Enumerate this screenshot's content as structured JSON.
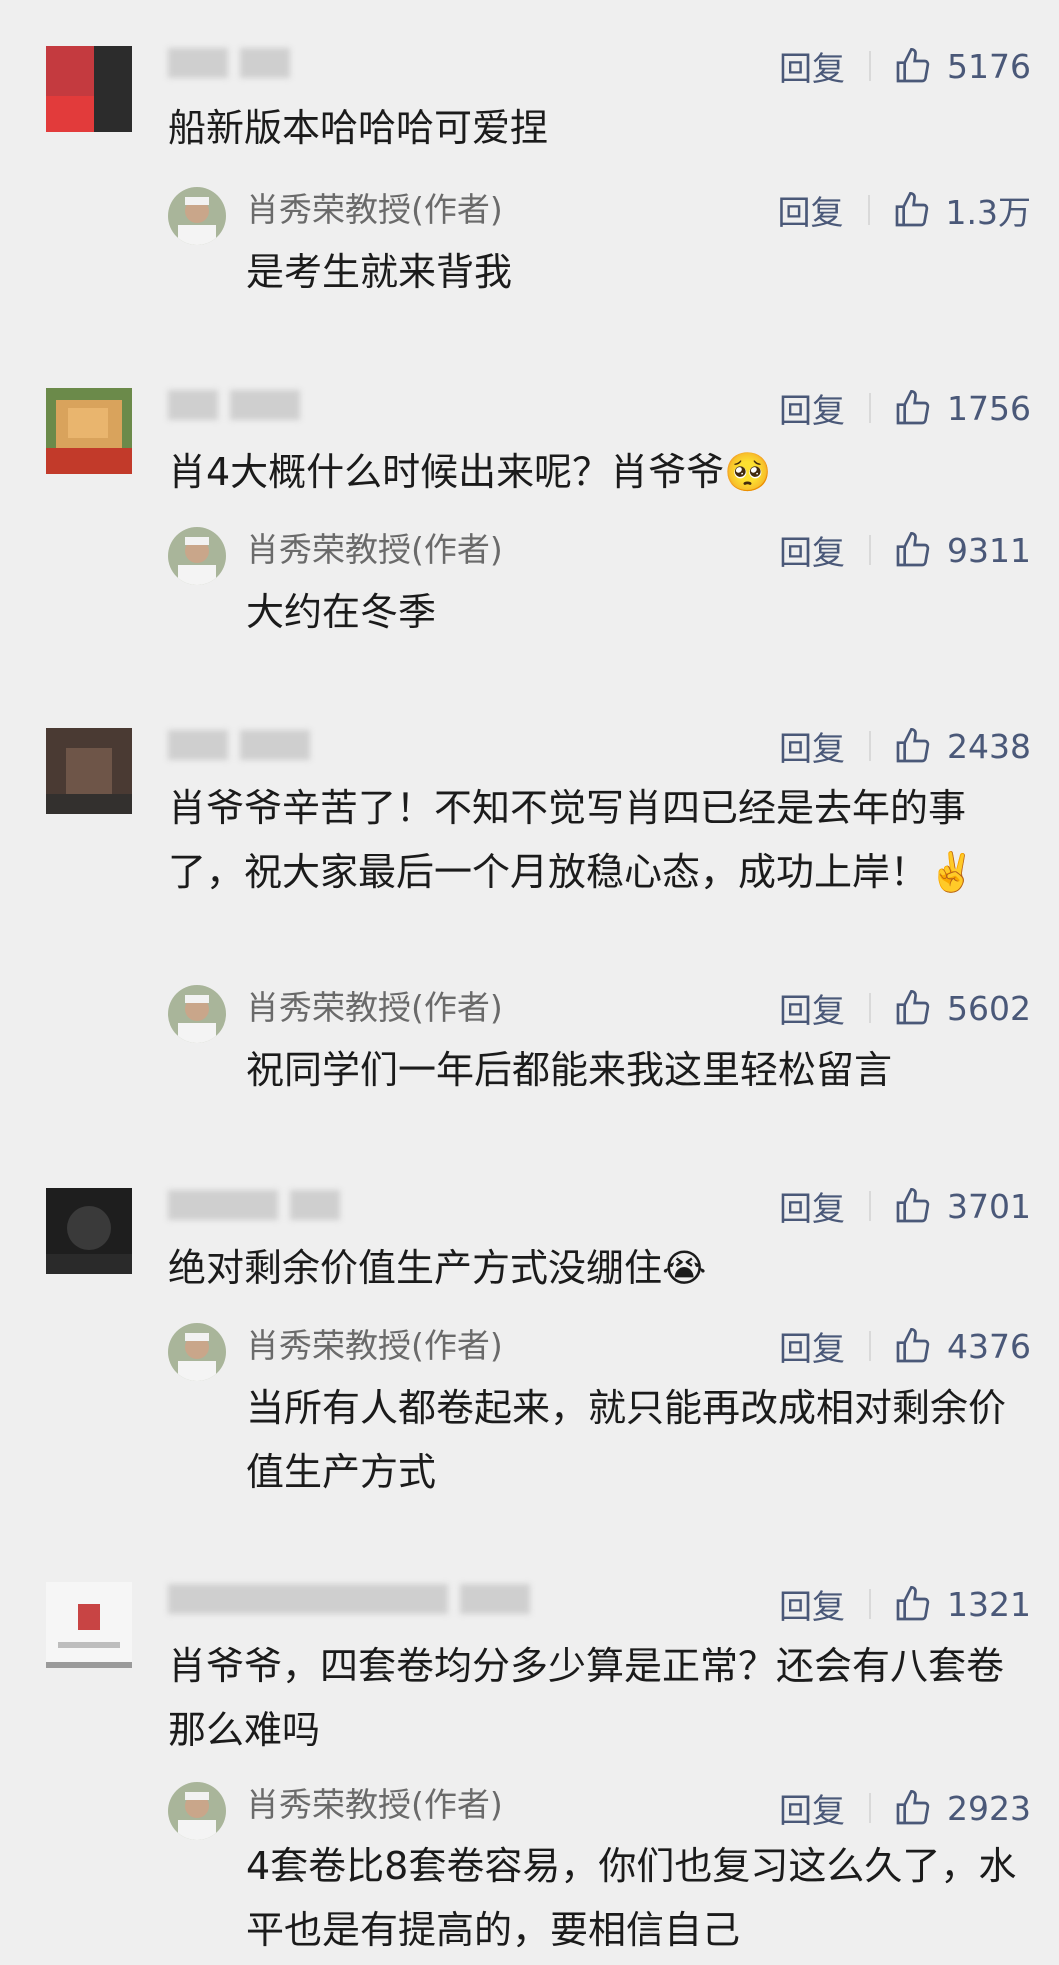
{
  "labels": {
    "reply": "回复",
    "author_name": "肖秀荣教授(作者)"
  },
  "comments": [
    {
      "text": "船新版本哈哈哈可爱捏",
      "likes": "5176",
      "reply": {
        "text": "是考生就来背我",
        "likes": "1.3万"
      }
    },
    {
      "text": "肖4大概什么时候出来呢？肖爷爷🥺",
      "likes": "1756",
      "reply": {
        "text": "大约在冬季",
        "likes": "9311"
      }
    },
    {
      "text": "肖爷爷辛苦了！不知不觉写肖四已经是去年的事了，祝大家最后一个月放稳心态，成功上岸！✌️",
      "likes": "2438",
      "reply": {
        "text": "祝同学们一年后都能来我这里轻松留言",
        "likes": "5602"
      }
    },
    {
      "text": "绝对剩余价值生产方式没绷住😭",
      "likes": "3701",
      "reply": {
        "text": "当所有人都卷起来，就只能再改成相对剩余价值生产方式",
        "likes": "4376"
      }
    },
    {
      "text": "肖爷爷，四套卷均分多少算是正常？还会有八套卷那么难吗",
      "likes": "1321",
      "reply": {
        "text": "4套卷比8套卷容易，你们也复习这么久了，水平也是有提高的，要相信自己",
        "likes": "2923"
      }
    }
  ]
}
